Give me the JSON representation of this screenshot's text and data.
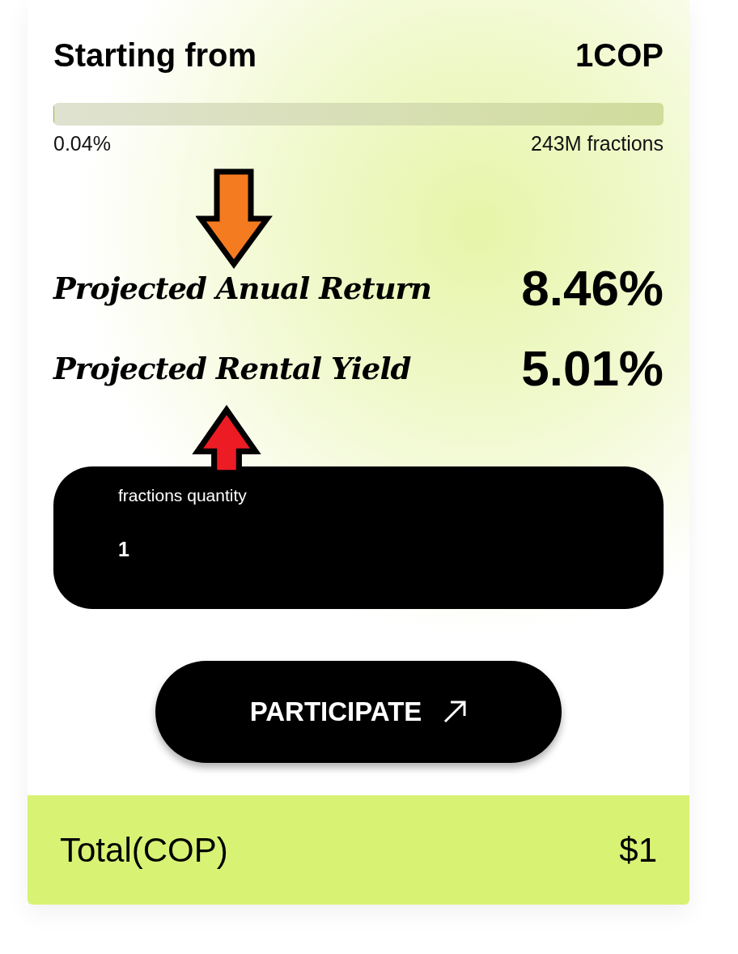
{
  "header": {
    "label": "Starting from",
    "price": "1COP"
  },
  "progress": {
    "level": 0.0004,
    "percent": "0.04%",
    "total": "243M fractions"
  },
  "metrics": [
    {
      "label": "Projected Anual Return",
      "value": "8.46%"
    },
    {
      "label": "Projected Rental Yield",
      "value": "5.01%"
    }
  ],
  "quantity_field": {
    "label": "fractions quantity",
    "value": "1"
  },
  "participate_button": {
    "label": "PARTICIPATE"
  },
  "total": {
    "label": "Total(COP)",
    "value": "$1"
  },
  "annotations": [
    {
      "kind": "down",
      "color": "#f47b20"
    },
    {
      "kind": "up",
      "color": "#ed1c24"
    }
  ]
}
